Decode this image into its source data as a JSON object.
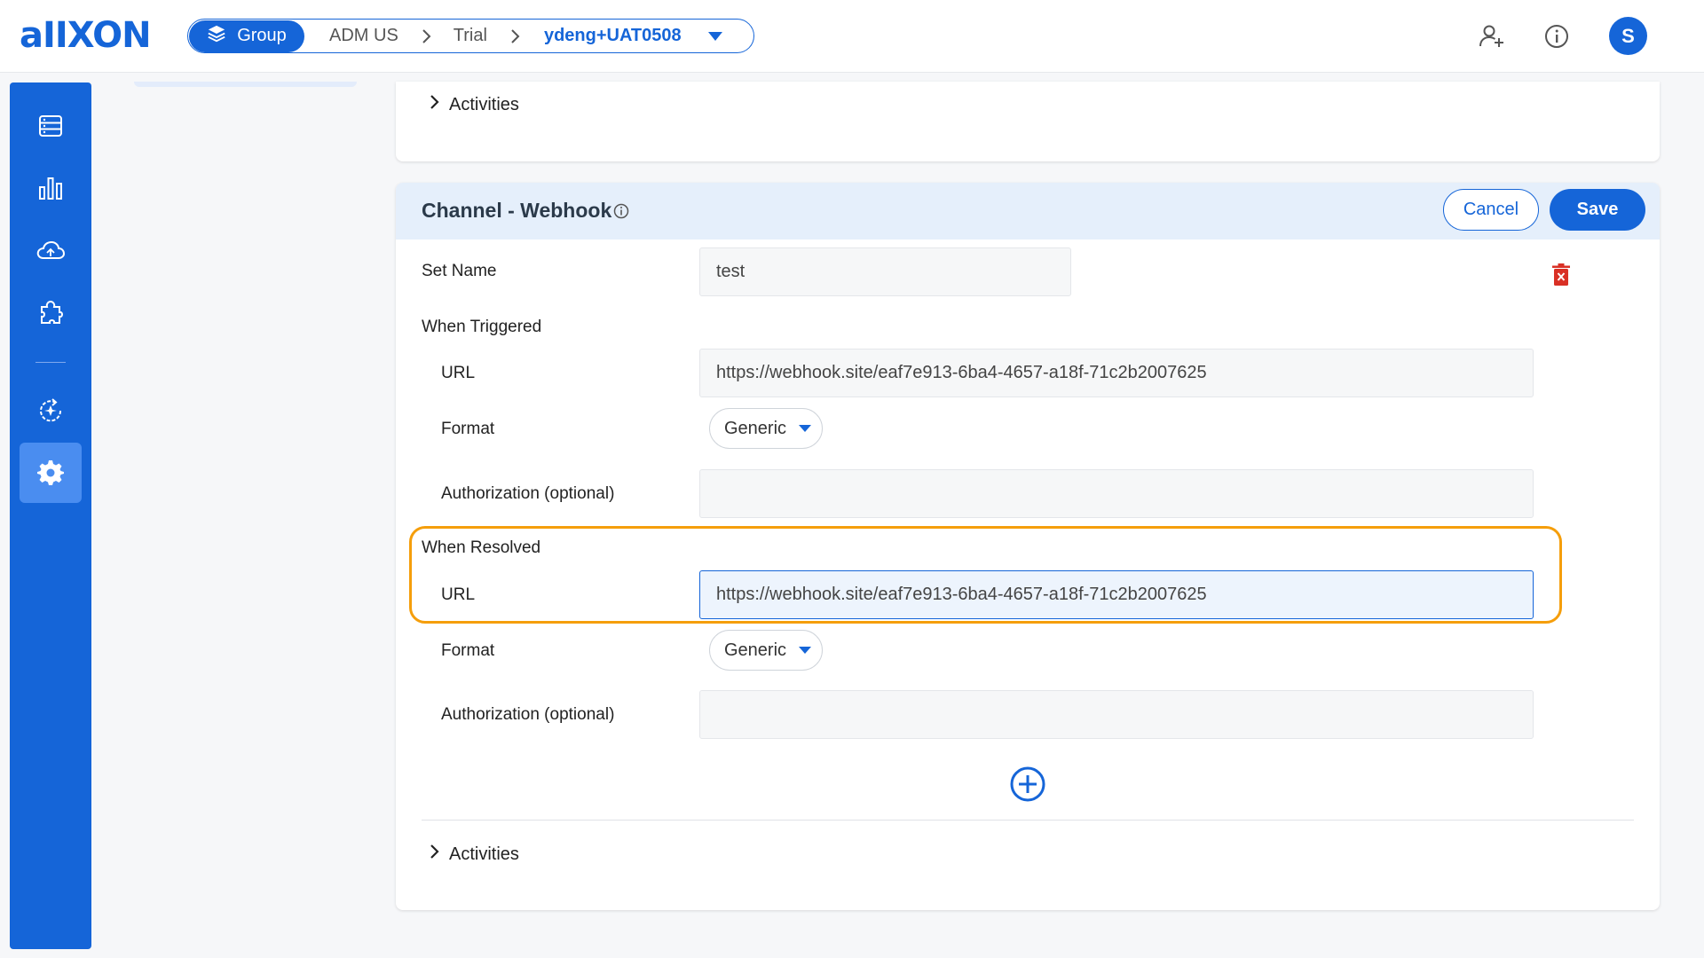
{
  "header": {
    "logo": "aIIXON",
    "breadcrumb": {
      "group_label": "Group",
      "items": [
        "ADM US",
        "Trial"
      ],
      "active": "ydeng+UAT0508"
    },
    "icons": [
      "add-user-icon",
      "info-icon"
    ],
    "avatar_initial": "S"
  },
  "sidebar": {
    "items": [
      "server-icon",
      "chart-icon",
      "cloud-sync-icon",
      "puzzle-icon",
      "update-icon",
      "gear-icon"
    ],
    "active": "gear-icon"
  },
  "top_card": {
    "activities_label": "Activities"
  },
  "channel": {
    "title": "Channel - Webhook",
    "cancel_label": "Cancel",
    "save_label": "Save",
    "set_name_label": "Set Name",
    "set_name_value": "test",
    "when_triggered": {
      "section_label": "When Triggered",
      "url_label": "URL",
      "url_value": "https://webhook.site/eaf7e913-6ba4-4657-a18f-71c2b2007625",
      "format_label": "Format",
      "format_value": "Generic",
      "auth_label": "Authorization (optional)",
      "auth_value": ""
    },
    "when_resolved": {
      "section_label": "When Resolved",
      "url_label": "URL",
      "url_value": "https://webhook.site/eaf7e913-6ba4-4657-a18f-71c2b2007625",
      "format_label": "Format",
      "format_value": "Generic",
      "auth_label": "Authorization (optional)",
      "auth_value": ""
    },
    "activities_label": "Activities"
  },
  "colors": {
    "primary": "#1565d8",
    "highlight": "#f59e0b",
    "delete": "#d93025"
  }
}
